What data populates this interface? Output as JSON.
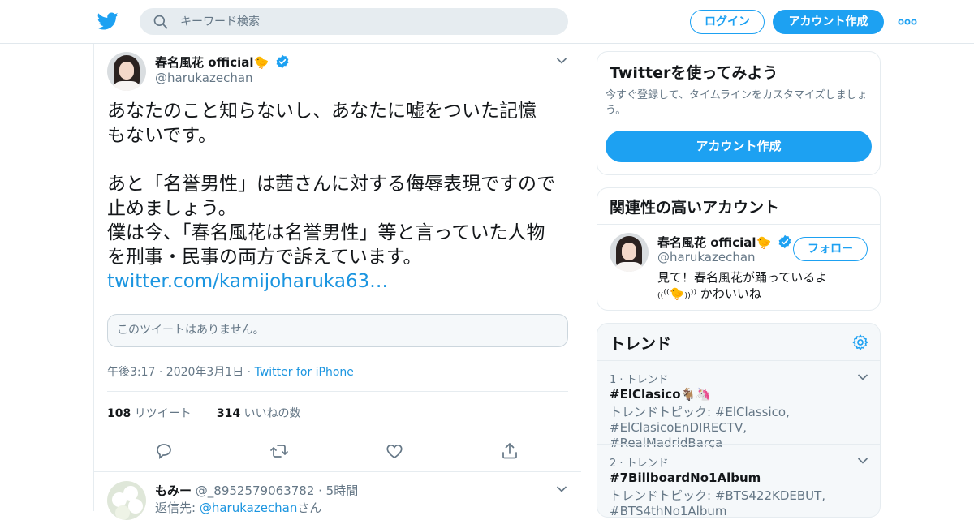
{
  "header": {
    "search_placeholder": "キーワード検索",
    "login_label": "ログイン",
    "signup_label": "アカウント作成"
  },
  "tweet": {
    "name": "春名風花 official🐤",
    "handle": "@harukazechan",
    "text_lines": [
      "あなたのこと知らないし、あなたに嘘をついた記憶",
      "もないです。",
      "",
      "あと「名誉男性」は茜さんに対する侮辱表現ですので",
      "止めましょう。",
      "僕は今、「春名風花は名誉男性」等と言っていた人物",
      "を刑事・民事の両方で訴えています。"
    ],
    "link": "twitter.com/kamijoharuka63…",
    "quote_unavailable": "このツイートはありません。",
    "time": "午後3:17 · 2020年3月1日 · ",
    "source": "Twitter for iPhone",
    "retweets_count": "108",
    "retweets_label": "リツイート",
    "likes_count": "314",
    "likes_label": "いいねの数"
  },
  "reply": {
    "name": "もみー",
    "handle": "@_8952579063782",
    "time": " · 5時間",
    "reply_to_prefix": "返信先: ",
    "reply_to_handle": "@harukazechan",
    "reply_to_suffix": "さん"
  },
  "sidebar": {
    "signup_card": {
      "title": "Twitterを使ってみよう",
      "subtitle": "今すぐ登録して、タイムラインをカスタマイズしましょう。",
      "button": "アカウント作成"
    },
    "related": {
      "title": "関連性の高いアカウント",
      "name": "春名風花 official🐤",
      "handle": "@harukazechan",
      "follow_label": "フォロー",
      "bio_line1": "見て！春名風花が踊っているよ",
      "bio_line2": "₍₍⁽⁽🐤₎₎⁾⁾ かわいいね"
    },
    "trends": {
      "title": "トレンド",
      "items": [
        {
          "rank": "1 · トレンド",
          "name": "#ElClasico🐐🦄",
          "desc": "トレンドトピック: #ElClassico, #ElClasicoEnDIRECTV, #RealMadridBarça"
        },
        {
          "rank": "2 · トレンド",
          "name": "#7BillboardNo1Album",
          "desc": "トレンドトピック: #BTS422KDEBUT, #BTS4thNo1Album"
        }
      ]
    }
  },
  "colors": {
    "accent": "#1da1f2",
    "link": "#1b95e0",
    "muted": "#657786"
  }
}
